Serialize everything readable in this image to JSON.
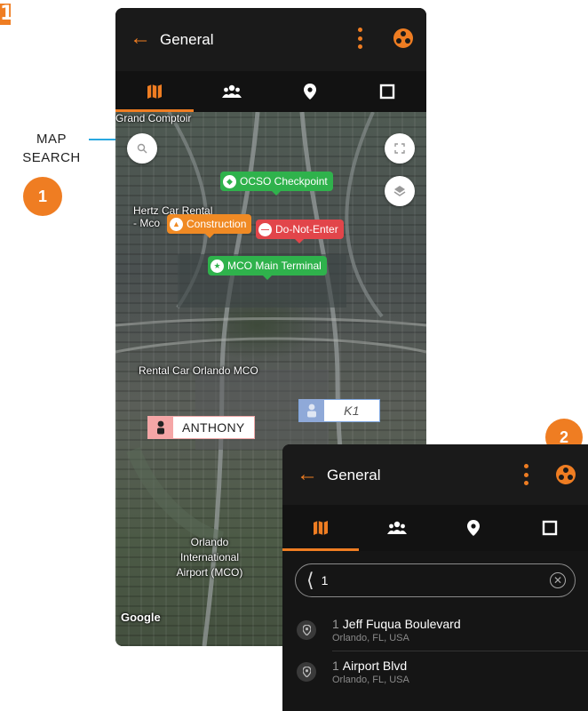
{
  "steps": {
    "one": "1",
    "two": "2"
  },
  "annotation": {
    "line1": "MAP",
    "line2": "SEARCH"
  },
  "header": {
    "title": "General"
  },
  "tabs": [
    {
      "icon": "map-icon"
    },
    {
      "icon": "group-icon"
    },
    {
      "icon": "location-pin-icon"
    },
    {
      "icon": "square-icon"
    }
  ],
  "map": {
    "labels": {
      "grand_comptoir": "Grand Comptoir",
      "hertz_1": "Hertz Car Rental",
      "hertz_2": "- Mco",
      "rental": "Rental Car Orlando MCO",
      "airport_1": "Orlando",
      "airport_2": "International",
      "airport_3": "Airport (MCO)",
      "google": "Google"
    },
    "pins": {
      "ocso": "OCSO Checkpoint",
      "construction": "Construction",
      "dne": "Do-Not-Enter",
      "terminal": "MCO Main Terminal"
    },
    "users": {
      "anthony": "ANTHONY",
      "k1": "K1"
    }
  },
  "search": {
    "value": "1"
  },
  "results": [
    {
      "num": "1",
      "name": "Jeff Fuqua Boulevard",
      "sub": "Orlando, FL, USA"
    },
    {
      "num": "1",
      "name": "Airport Blvd",
      "sub": "Orlando, FL, USA"
    }
  ],
  "colors": {
    "accent": "#ef7d22",
    "green": "#2fb24c",
    "red": "#e2454a",
    "orange": "#f08a24"
  }
}
